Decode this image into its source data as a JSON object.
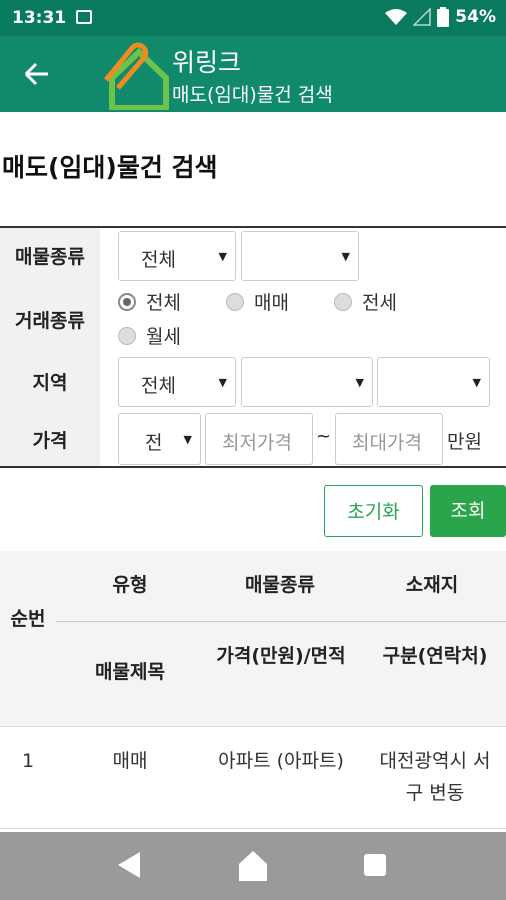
{
  "status_bar": {
    "time": "13:31",
    "battery": "54%"
  },
  "app_bar": {
    "title": "위링크",
    "subtitle": "매도(임대)물건 검색"
  },
  "page_title": "매도(임대)물건 검색",
  "form": {
    "property_type": {
      "label": "매물종류",
      "select1": "전체",
      "select2": ""
    },
    "deal_type": {
      "label": "거래종류",
      "options": [
        "전체",
        "매매",
        "전세",
        "월세"
      ],
      "selected": "전체"
    },
    "region": {
      "label": "지역",
      "select1": "전체",
      "select2": "",
      "select3": ""
    },
    "price": {
      "label": "가격",
      "select": "전",
      "min_placeholder": "최저가격",
      "tilde": "~",
      "max_placeholder": "최대가격",
      "unit": "만원"
    }
  },
  "buttons": {
    "reset": "초기화",
    "search": "조회"
  },
  "table": {
    "headers": {
      "no": "순번",
      "type": "유형",
      "property_type": "매물종류",
      "location": "소재지",
      "title": "매물제목",
      "price_area": "가격(만원)/면적",
      "category_contact": "구분(연락처)"
    },
    "rows": [
      {
        "no": "1",
        "type": "매매",
        "property_type": "아파트 (아파트)",
        "location": "대전광역시 서구 변동"
      }
    ]
  },
  "colors": {
    "status_bar": "#0a7a5f",
    "app_bar": "#11896b",
    "accent_green": "#2aa54c"
  }
}
